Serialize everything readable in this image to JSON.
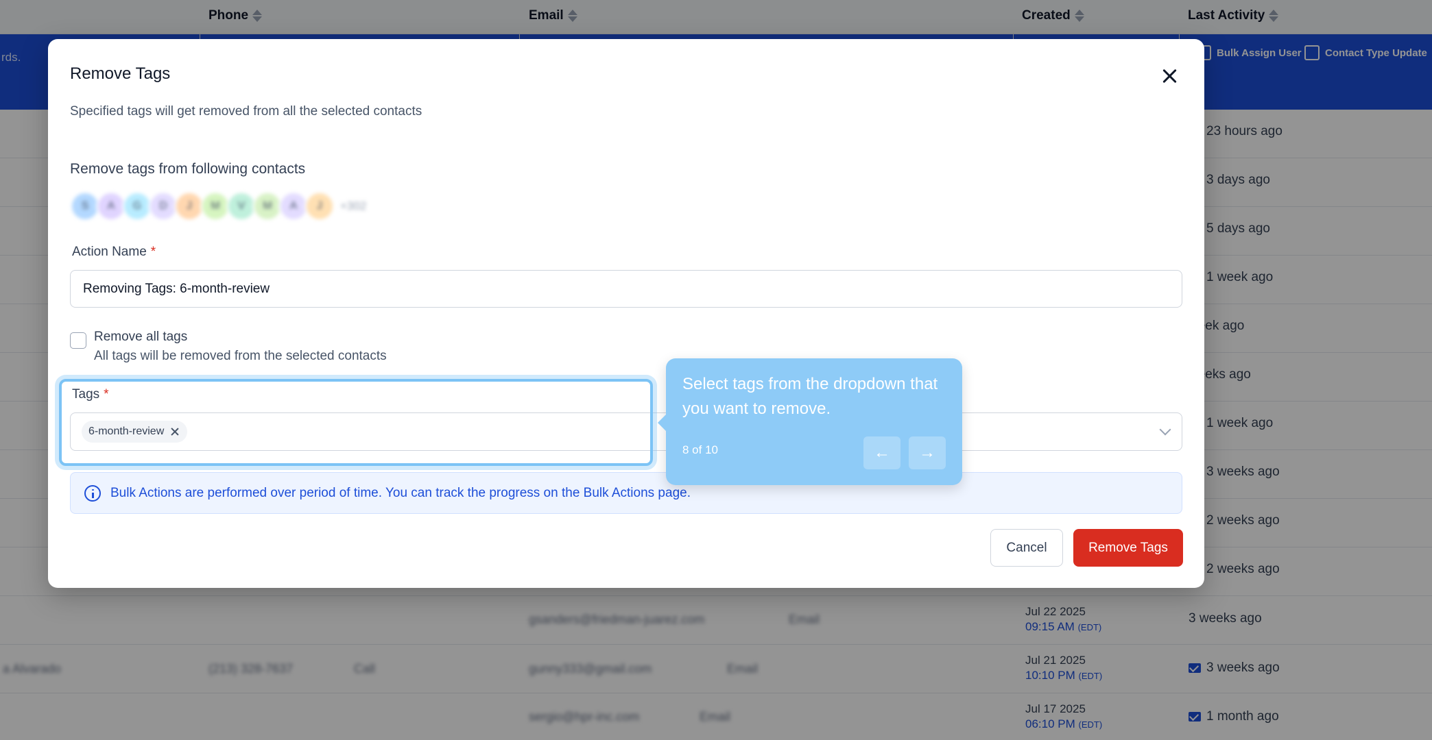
{
  "table": {
    "headers": {
      "phone": "Phone",
      "email": "Email",
      "created": "Created",
      "last_activity": "Last Activity"
    },
    "bulk_left_text": "rds.",
    "bulk_actions": [
      "Bulk Assign User",
      "Contact Type Update"
    ],
    "rows": [
      {
        "activity": "23 hours ago"
      },
      {
        "activity": "3 days ago"
      },
      {
        "activity": "5 days ago"
      },
      {
        "activity": "1 week ago"
      },
      {
        "activity": "week ago"
      },
      {
        "activity": "weeks ago"
      },
      {
        "activity": "1 week ago"
      },
      {
        "activity": "3 weeks ago"
      },
      {
        "activity": "2 weeks ago"
      },
      {
        "activity": "2 weeks ago"
      },
      {
        "created_date": "Jul 22 2025",
        "created_time": "09:15 AM",
        "tz": "(EDT)",
        "activity": "3 weeks ago",
        "email": "gsanders@friedman-juarez.com",
        "email_btn": "Email"
      },
      {
        "created_date": "Jul 21 2025",
        "created_time": "10:10 PM",
        "tz": "(EDT)",
        "activity": "3 weeks ago",
        "email": "gunny333@gmail.com",
        "email_btn": "Email",
        "phone": "(213) 328-7637",
        "call_btn": "Call",
        "name": "a Alvarado"
      },
      {
        "created_date": "Jul 17 2025",
        "created_time": "06:10 PM",
        "tz": "(EDT)",
        "activity": "1 month ago",
        "email": "sergio@hpr-inc.com",
        "email_btn": "Email"
      }
    ]
  },
  "modal": {
    "title": "Remove Tags",
    "subtitle": "Specified tags will get removed from all the selected contacts",
    "contacts_label": "Remove tags from following contacts",
    "avatars": [
      {
        "initial": "S",
        "color": "#b3d8ff"
      },
      {
        "initial": "A",
        "color": "#e0d4ff"
      },
      {
        "initial": "G",
        "color": "#b8ecff"
      },
      {
        "initial": "D",
        "color": "#e3dcff"
      },
      {
        "initial": "J",
        "color": "#ffd7b0"
      },
      {
        "initial": "M",
        "color": "#d6f5c0"
      },
      {
        "initial": "V",
        "color": "#bff0dc"
      },
      {
        "initial": "M",
        "color": "#d8f2c6"
      },
      {
        "initial": "A",
        "color": "#e3dcff"
      },
      {
        "initial": "J",
        "color": "#ffe0b3"
      }
    ],
    "more_count": "+302",
    "action_name_label": "Action Name",
    "action_name_value": "Removing Tags: 6-month-review",
    "remove_all_label": "Remove all tags",
    "remove_all_desc": "All tags will be removed from the selected contacts",
    "tags_label": "Tags",
    "selected_tag": "6-month-review",
    "info_text": "Bulk Actions are performed over period of time. You can track the progress on the Bulk Actions page.",
    "cancel_label": "Cancel",
    "submit_label": "Remove Tags",
    "required_mark": "*"
  },
  "tour": {
    "text": "Select tags from the dropdown that you want to remove.",
    "step": "8 of 10",
    "prev_glyph": "←",
    "next_glyph": "→"
  }
}
